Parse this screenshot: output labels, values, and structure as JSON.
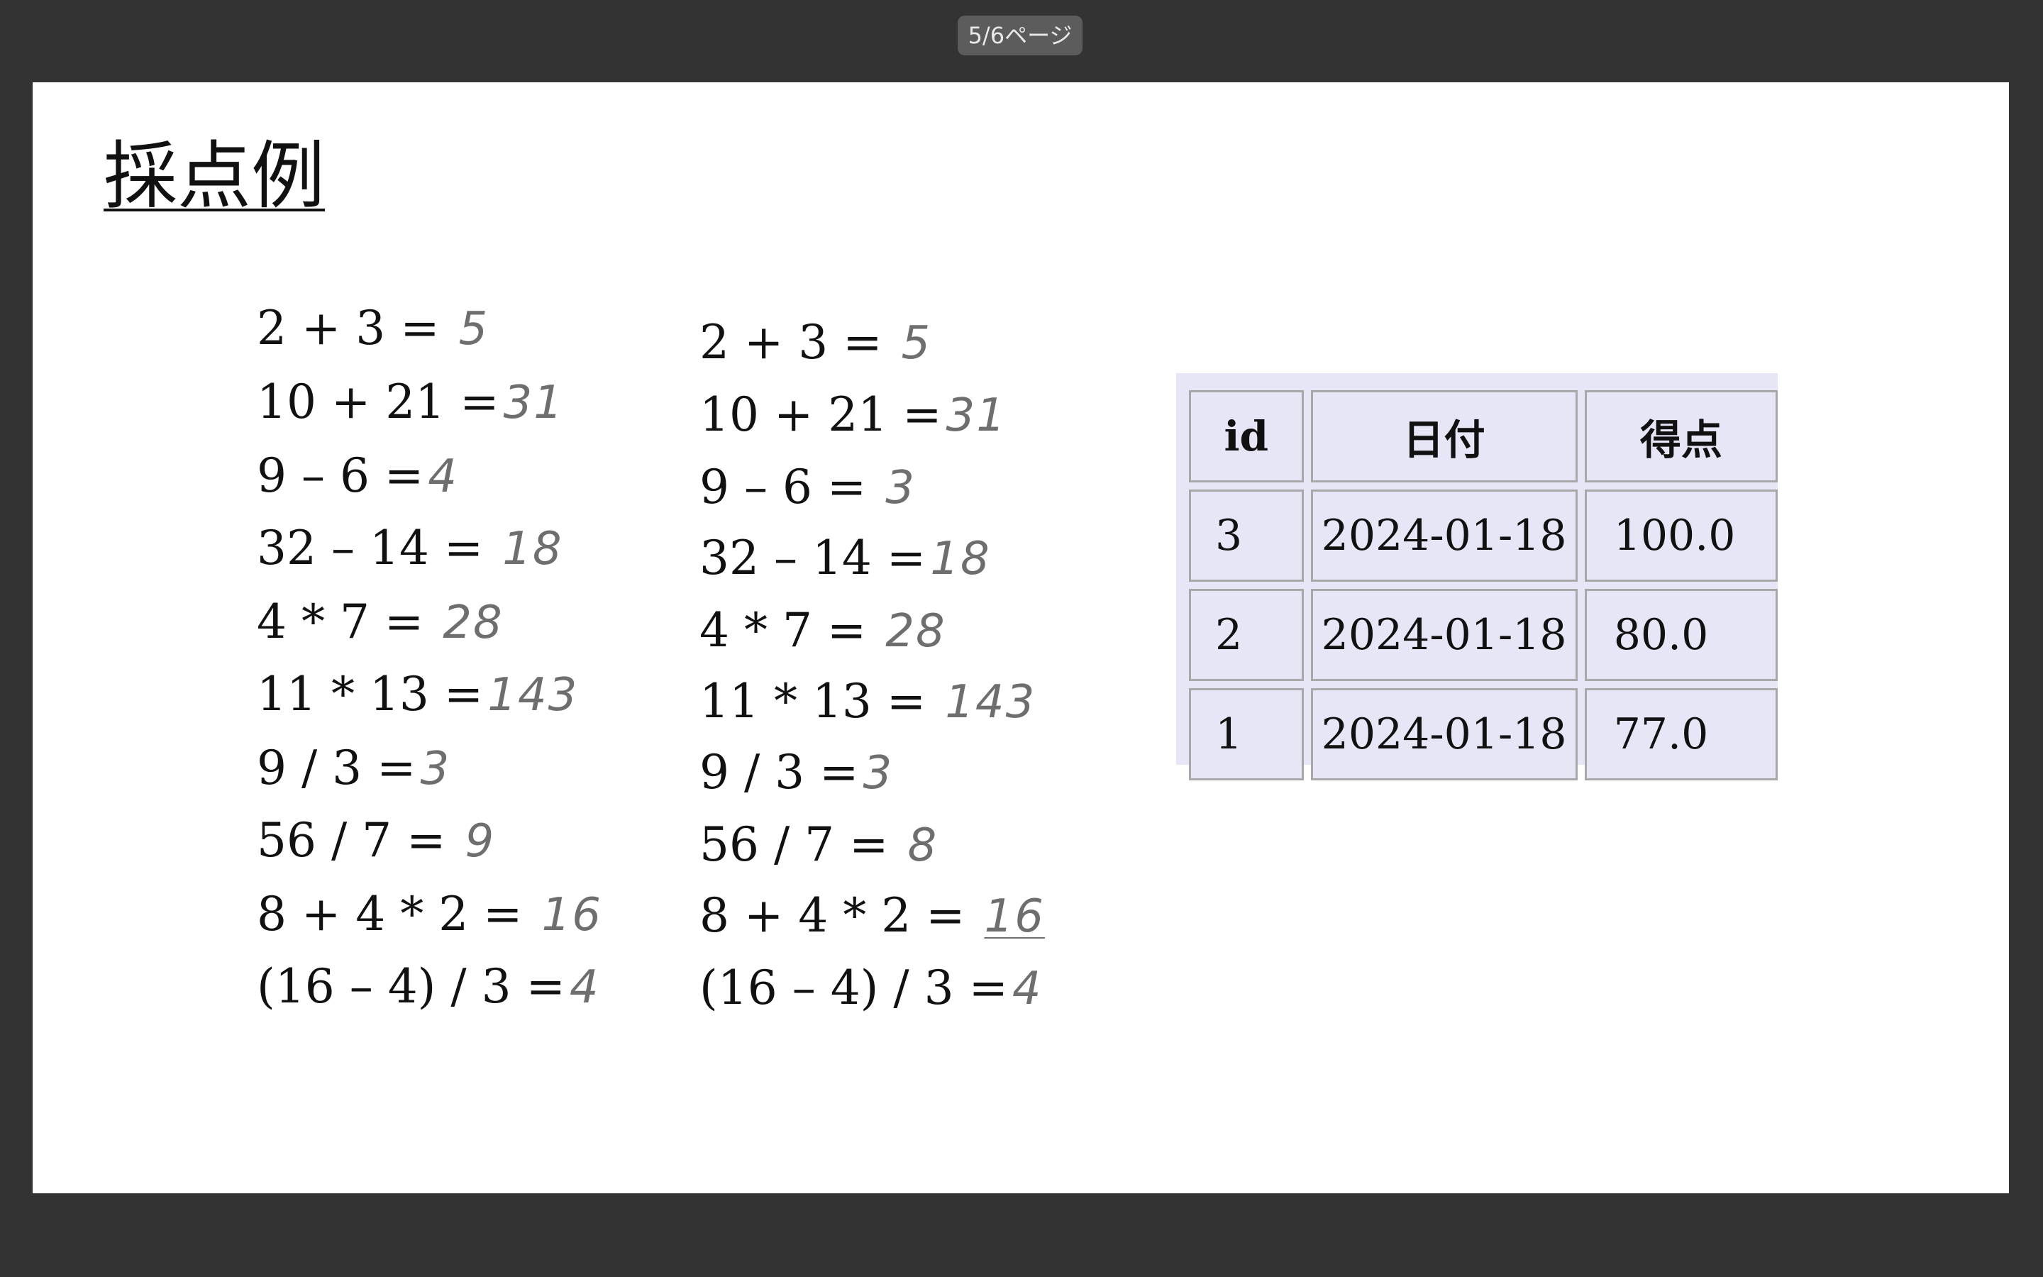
{
  "viewer": {
    "page_indicator": "5/6ページ"
  },
  "slide": {
    "title": "採点例",
    "sheets": [
      {
        "problems": [
          {
            "expr": "2 + 3 =",
            "answer": "5"
          },
          {
            "expr": "10 + 21 =",
            "answer": "31"
          },
          {
            "expr": "9 – 6 =",
            "answer": "4"
          },
          {
            "expr": "32 – 14 =",
            "answer": "18"
          },
          {
            "expr": "4 * 7 =",
            "answer": "28"
          },
          {
            "expr": "11 * 13 =",
            "answer": "143"
          },
          {
            "expr": "9 / 3 =",
            "answer": "3"
          },
          {
            "expr": "56 / 7 =",
            "answer": "9"
          },
          {
            "expr": "8 + 4 * 2 =",
            "answer": "16"
          },
          {
            "expr": "(16 – 4) / 3 =",
            "answer": "4"
          }
        ]
      },
      {
        "problems": [
          {
            "expr": "2 + 3 =",
            "answer": "5"
          },
          {
            "expr": "10 + 21 =",
            "answer": "31"
          },
          {
            "expr": "9 – 6 =",
            "answer": "3"
          },
          {
            "expr": "32 – 14 =",
            "answer": "18"
          },
          {
            "expr": "4 * 7 =",
            "answer": "28"
          },
          {
            "expr": "11 * 13 =",
            "answer": "143"
          },
          {
            "expr": "9 / 3 =",
            "answer": "3"
          },
          {
            "expr": "56 / 7 =",
            "answer": "8"
          },
          {
            "expr": "8 + 4 * 2 =",
            "answer": "16"
          },
          {
            "expr": "(16 – 4) / 3 =",
            "answer": "4"
          }
        ]
      }
    ],
    "table": {
      "headers": [
        "id",
        "日付",
        "得点"
      ],
      "rows": [
        [
          "3",
          "2024-01-18",
          "100.0"
        ],
        [
          "2",
          "2024-01-18",
          "80.0"
        ],
        [
          "1",
          "2024-01-18",
          "77.0"
        ]
      ],
      "background_color": "#e6e6f7",
      "border_color": "#a8a8a8"
    }
  }
}
